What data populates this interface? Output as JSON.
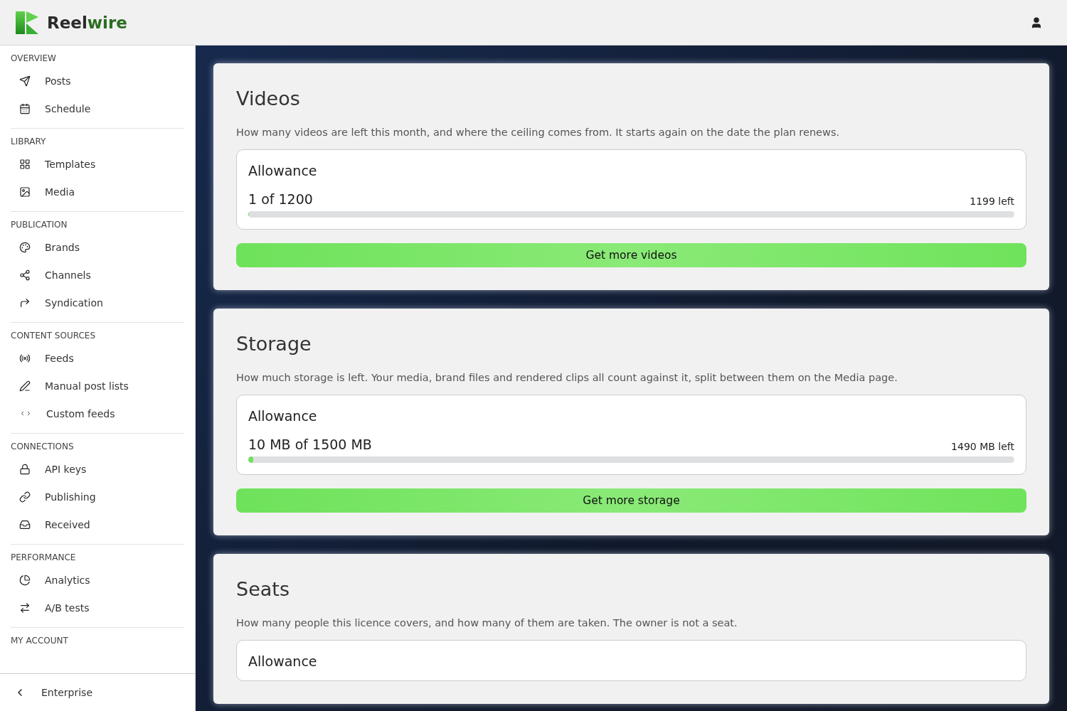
{
  "logo": {
    "first": "Reel",
    "second": "wire"
  },
  "sidebar": {
    "sections": [
      {
        "title": "OVERVIEW",
        "items": [
          {
            "label": "Posts"
          },
          {
            "label": "Schedule"
          }
        ]
      },
      {
        "title": "LIBRARY",
        "items": [
          {
            "label": "Templates"
          },
          {
            "label": "Media"
          }
        ]
      },
      {
        "title": "PUBLICATION",
        "items": [
          {
            "label": "Brands"
          },
          {
            "label": "Channels"
          },
          {
            "label": "Syndication"
          }
        ]
      },
      {
        "title": "CONTENT SOURCES",
        "items": [
          {
            "label": "Feeds"
          },
          {
            "label": "Manual post lists"
          },
          {
            "label": "Custom feeds"
          }
        ]
      },
      {
        "title": "CONNECTIONS",
        "items": [
          {
            "label": "API keys"
          },
          {
            "label": "Publishing"
          },
          {
            "label": "Received"
          }
        ]
      },
      {
        "title": "PERFORMANCE",
        "items": [
          {
            "label": "Analytics"
          },
          {
            "label": "A/B tests"
          }
        ]
      },
      {
        "title": "MY ACCOUNT"
      }
    ],
    "footer": {
      "label": "Enterprise"
    }
  },
  "cards": [
    {
      "title": "Videos",
      "description": "How many videos are left this month, and where the ceiling comes from. It starts again on the date the plan renews.",
      "allowance": {
        "heading": "Allowance",
        "usage": "1 of 1200",
        "left": "1199 left",
        "level": 0.0008
      },
      "button": "Get more videos"
    },
    {
      "title": "Storage",
      "description": "How much storage is left. Your media, brand files and rendered clips all count against it, split between them on the Media page.",
      "allowance": {
        "heading": "Allowance",
        "usage": "10 MB of 1500 MB",
        "left": "1490 MB left",
        "level": 0.0067
      },
      "button": "Get more storage"
    },
    {
      "title": "Seats",
      "description": "How many people this licence covers, and how many of them are taken. The owner is not a seat.",
      "allowance": {
        "heading": "Allowance"
      }
    }
  ]
}
